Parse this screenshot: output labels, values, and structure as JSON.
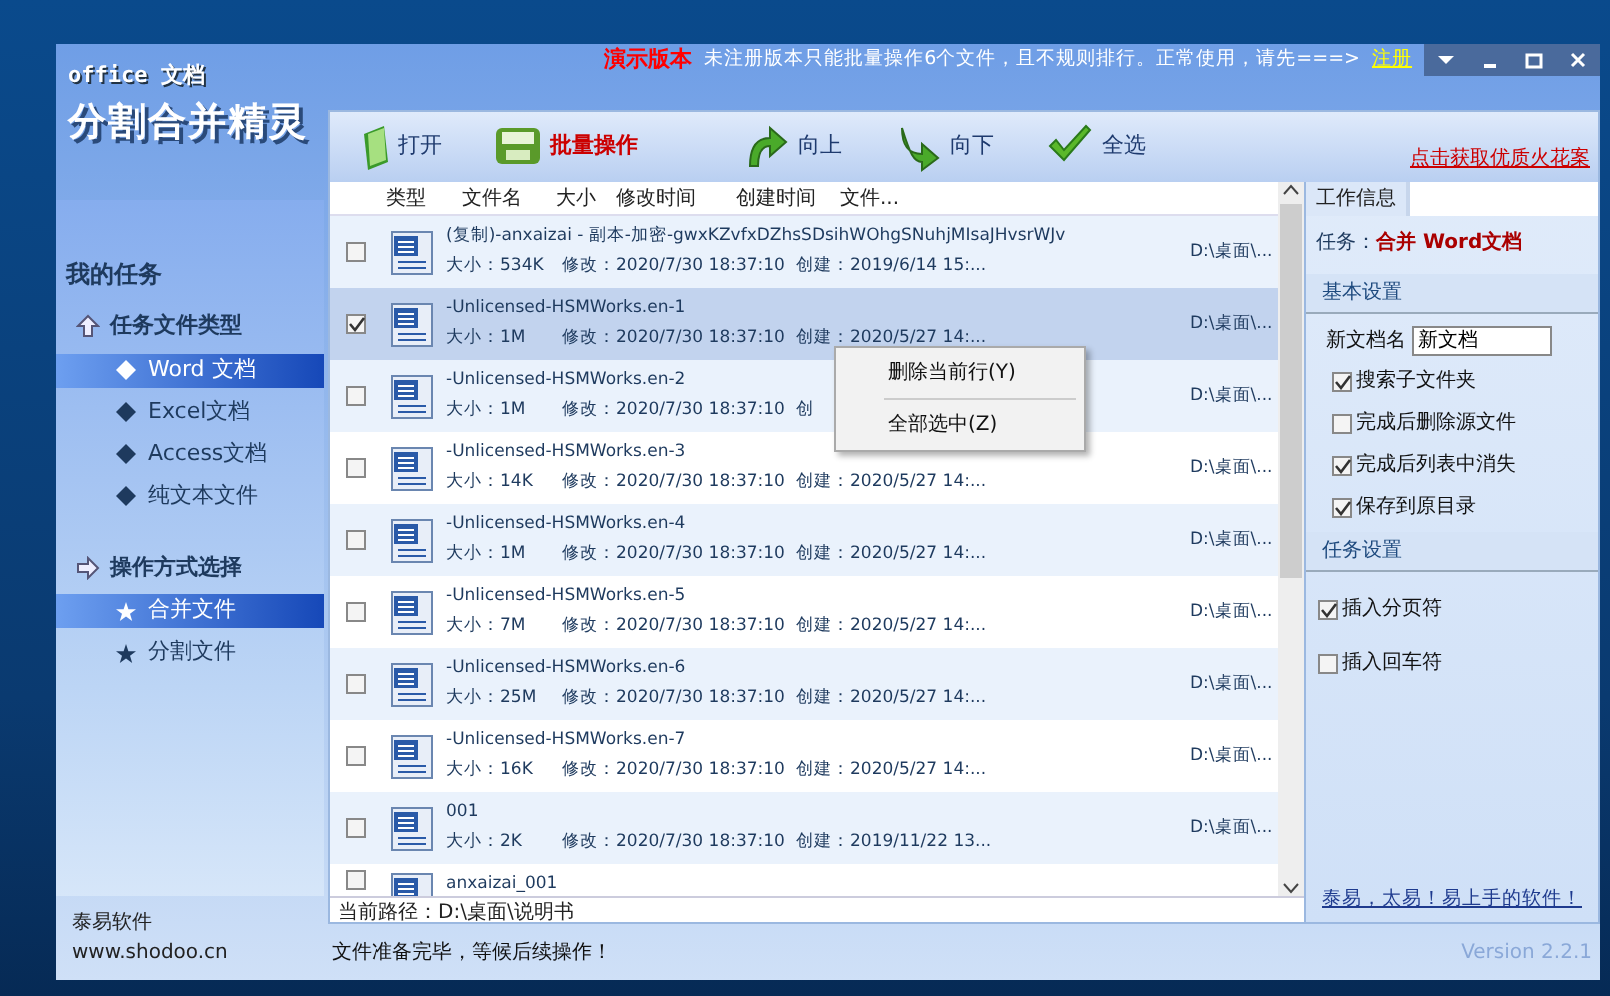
{
  "window": {
    "demo_label": "演示版本",
    "notice": "未注册版本只能批量操作6个文件，且不规则排行。正常使用，请先===>",
    "register_link": "注册"
  },
  "logo": {
    "line_1": "office 文档",
    "line_2": "分割合并精灵"
  },
  "sidebar": {
    "title": "我的任务",
    "groups": [
      {
        "label": "任务文件类型",
        "items": [
          {
            "label": "Word 文档",
            "kind": "diamond",
            "selected": true
          },
          {
            "label": "Excel文档",
            "kind": "diamond",
            "selected": false
          },
          {
            "label": "Access文档",
            "kind": "diamond",
            "selected": false
          },
          {
            "label": "纯文本文件",
            "kind": "diamond",
            "selected": false
          }
        ]
      },
      {
        "label": "操作方式选择",
        "items": [
          {
            "label": "合并文件",
            "kind": "star",
            "selected": true
          },
          {
            "label": "分割文件",
            "kind": "star",
            "selected": false
          }
        ]
      }
    ],
    "footer": "泰易软件 www.shodoo.cn"
  },
  "toolbar": {
    "buttons": [
      {
        "label": "打开",
        "kind": "open",
        "emphasis": false
      },
      {
        "label": "批量操作",
        "kind": "batch",
        "emphasis": true
      },
      {
        "label": "向上",
        "kind": "up",
        "emphasis": false
      },
      {
        "label": "向下",
        "kind": "down",
        "emphasis": false
      },
      {
        "label": "全选",
        "kind": "check",
        "emphasis": false
      }
    ],
    "promo_link": "点击获取优质火花案"
  },
  "table": {
    "columns": [
      "类型",
      "文件名",
      "大小",
      "修改时间",
      "创建时间",
      "文件..."
    ],
    "rows": [
      {
        "name": "(复制)-anxaizai - 副本-加密-gwxKZvfxDZhsSDsihWOhgSNuhjMIsaJHvsrWJv",
        "size": "大小：534K",
        "modified": "修改：2020/7/30 18:37:10",
        "created": "创建：2019/6/14 15:...",
        "path": "D:\\桌面\\...",
        "checked": false,
        "selected": false
      },
      {
        "name": "-Unlicensed-HSMWorks.en-1",
        "size": "大小：1M",
        "modified": "修改：2020/7/30 18:37:10",
        "created": "创建：2020/5/27 14:...",
        "path": "D:\\桌面\\...",
        "checked": true,
        "selected": true
      },
      {
        "name": "-Unlicensed-HSMWorks.en-2",
        "size": "大小：1M",
        "modified": "修改：2020/7/30 18:37:10",
        "created": "创",
        "path": "D:\\桌面\\...",
        "checked": false,
        "selected": false
      },
      {
        "name": "-Unlicensed-HSMWorks.en-3",
        "size": "大小：14K",
        "modified": "修改：2020/7/30 18:37:10",
        "created": "创建：2020/5/27 14:...",
        "path": "D:\\桌面\\...",
        "checked": false,
        "selected": false
      },
      {
        "name": "-Unlicensed-HSMWorks.en-4",
        "size": "大小：1M",
        "modified": "修改：2020/7/30 18:37:10",
        "created": "创建：2020/5/27 14:...",
        "path": "D:\\桌面\\...",
        "checked": false,
        "selected": false
      },
      {
        "name": "-Unlicensed-HSMWorks.en-5",
        "size": "大小：7M",
        "modified": "修改：2020/7/30 18:37:10",
        "created": "创建：2020/5/27 14:...",
        "path": "D:\\桌面\\...",
        "checked": false,
        "selected": false
      },
      {
        "name": "-Unlicensed-HSMWorks.en-6",
        "size": "大小：25M",
        "modified": "修改：2020/7/30 18:37:10",
        "created": "创建：2020/5/27 14:...",
        "path": "D:\\桌面\\...",
        "checked": false,
        "selected": false
      },
      {
        "name": "-Unlicensed-HSMWorks.en-7",
        "size": "大小：16K",
        "modified": "修改：2020/7/30 18:37:10",
        "created": "创建：2020/5/27 14:...",
        "path": "D:\\桌面\\...",
        "checked": false,
        "selected": false
      },
      {
        "name": "001",
        "size": "大小：2K",
        "modified": "修改：2020/7/30 18:37:10",
        "created": "创建：2019/11/22 13...",
        "path": "D:\\桌面\\...",
        "checked": false,
        "selected": false
      },
      {
        "name": "anxaizai_001",
        "checked": false,
        "selected": false
      }
    ]
  },
  "context_menu": {
    "items": [
      {
        "label": "删除当前行(Y)"
      },
      {
        "label": "全部选中(Z)"
      }
    ]
  },
  "path_bar": "当前路径：D:\\桌面\\说明书",
  "info_panel": {
    "tab": "工作信息",
    "task_label": "任务：",
    "task_value": "合并 Word文档",
    "sections": [
      {
        "title": "基本设置",
        "field": {
          "label": "新文档名",
          "value": "新文档"
        },
        "options": [
          {
            "label": "搜索子文件夹",
            "checked": true
          },
          {
            "label": "完成后删除源文件",
            "checked": false
          },
          {
            "label": "完成后列表中消失",
            "checked": true
          },
          {
            "label": "保存到原目录",
            "checked": true
          }
        ]
      },
      {
        "title": "任务设置",
        "options": [
          {
            "label": "插入分页符",
            "checked": true
          },
          {
            "label": "插入回车符",
            "checked": false
          }
        ]
      }
    ],
    "footer_link": "泰易，太易！易上手的软件！"
  },
  "status_bar": {
    "text": "文件准备完毕，等候后续操作！",
    "version": "Version 2.2.1"
  }
}
